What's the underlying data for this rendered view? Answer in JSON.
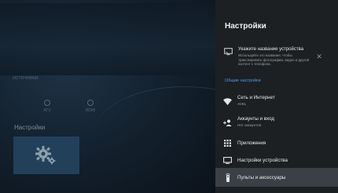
{
  "background": {
    "inputs_label": "источники",
    "input_tiles": [
      {
        "label": "ATV"
      },
      {
        "label": "HDMI"
      }
    ],
    "settings_label": "Настройки",
    "settings_tile_icon": "gear-icon"
  },
  "panel": {
    "title": "Настройки",
    "device_name": {
      "title": "Укажите название устройства",
      "description": "Используйте это название, чтобы транслировать фотографии, видео и другой контент с телефона.",
      "icon": "cast-icon",
      "close_icon": "close-icon",
      "close_glyph": "✕"
    },
    "section_label": "Общие настройки",
    "items": [
      {
        "title": "Сеть и Интернет",
        "subtitle": "AVEL",
        "icon": "wifi-icon"
      },
      {
        "title": "Аккаунты и вход",
        "subtitle": "Нет аккаунтов",
        "icon": "add-account-icon"
      },
      {
        "title": "Приложения",
        "subtitle": "",
        "icon": "apps-grid-icon"
      },
      {
        "title": "Настройки устройства",
        "subtitle": "",
        "icon": "tv-icon"
      },
      {
        "title": "Пульты и аксессуары",
        "subtitle": "",
        "icon": "remote-icon"
      }
    ],
    "selected_index": 4
  },
  "colors": {
    "panel_bg": "#1c2023",
    "selected_bg": "#3a4046",
    "accent": "#4f9be6",
    "settings_tile": "#22405a"
  }
}
